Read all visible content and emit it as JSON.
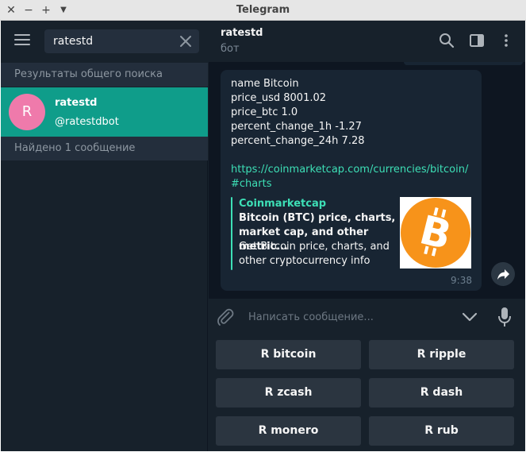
{
  "window": {
    "title": "Telegram"
  },
  "search": {
    "value": "ratestd"
  },
  "results": {
    "global_label": "Результаты общего поиска",
    "found_label": "Найдено 1 сообщение",
    "chat": {
      "avatar_letter": "R",
      "name": "ratestd",
      "username": "@ratestdbot"
    }
  },
  "chat_header": {
    "title": "ratestd",
    "status": "бот"
  },
  "message": {
    "lines": [
      "name Bitcoin",
      "price_usd 8001.02",
      "price_btc 1.0",
      "percent_change_1h -1.27",
      "percent_change_24h 7.28"
    ],
    "link": "https://coinmarketcap.com/currencies/bitcoin/#charts",
    "preview": {
      "site": "Coinmarketcap",
      "title": "Bitcoin (BTC) price, charts, market cap, and other metric...",
      "description": "Get Bitcoin price, charts, and other cryptocurrency info"
    },
    "time": "9:38"
  },
  "composer": {
    "placeholder": "Написать сообщение..."
  },
  "keyboard": {
    "buttons": [
      "R bitcoin",
      "R ripple",
      "R zcash",
      "R dash",
      "R monero",
      "R rub"
    ]
  },
  "colors": {
    "accent": "#0f9d8a",
    "link": "#3ddfb6",
    "avatar": "#ef7aab",
    "bitcoin": "#f7931a"
  }
}
